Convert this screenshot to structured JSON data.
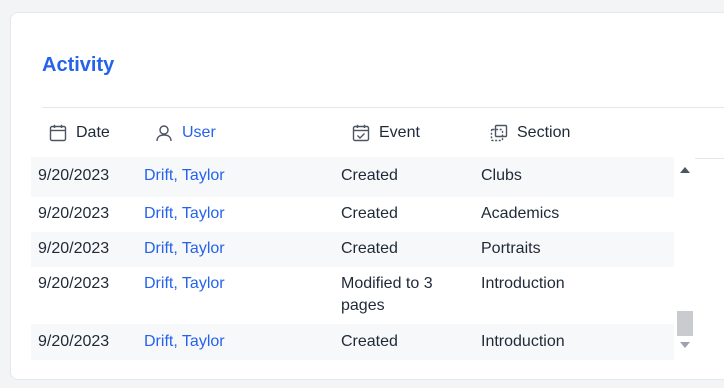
{
  "card": {
    "title": "Activity"
  },
  "columns": {
    "date": "Date",
    "user": "User",
    "event": "Event",
    "section": "Section"
  },
  "icons": {
    "date": "calendar-icon",
    "user": "user-icon",
    "event": "calendar-check-icon",
    "section": "section-icon"
  },
  "rows": [
    {
      "date": "9/20/2023",
      "user": "Drift, Taylor",
      "event": "Created",
      "section": "Clubs"
    },
    {
      "date": "9/20/2023",
      "user": "Drift, Taylor",
      "event": "Created",
      "section": "Academics"
    },
    {
      "date": "9/20/2023",
      "user": "Drift, Taylor",
      "event": "Created",
      "section": "Portraits"
    },
    {
      "date": "9/20/2023",
      "user": "Drift, Taylor",
      "event": "Modified to 3 pages",
      "section": "Introduction"
    },
    {
      "date": "9/20/2023",
      "user": "Drift, Taylor",
      "event": "Created",
      "section": "Introduction"
    }
  ],
  "colors": {
    "accent": "#2563eb",
    "text": "#1f2937",
    "row_shade": "#f7f8fa",
    "border": "#e5e7eb"
  }
}
